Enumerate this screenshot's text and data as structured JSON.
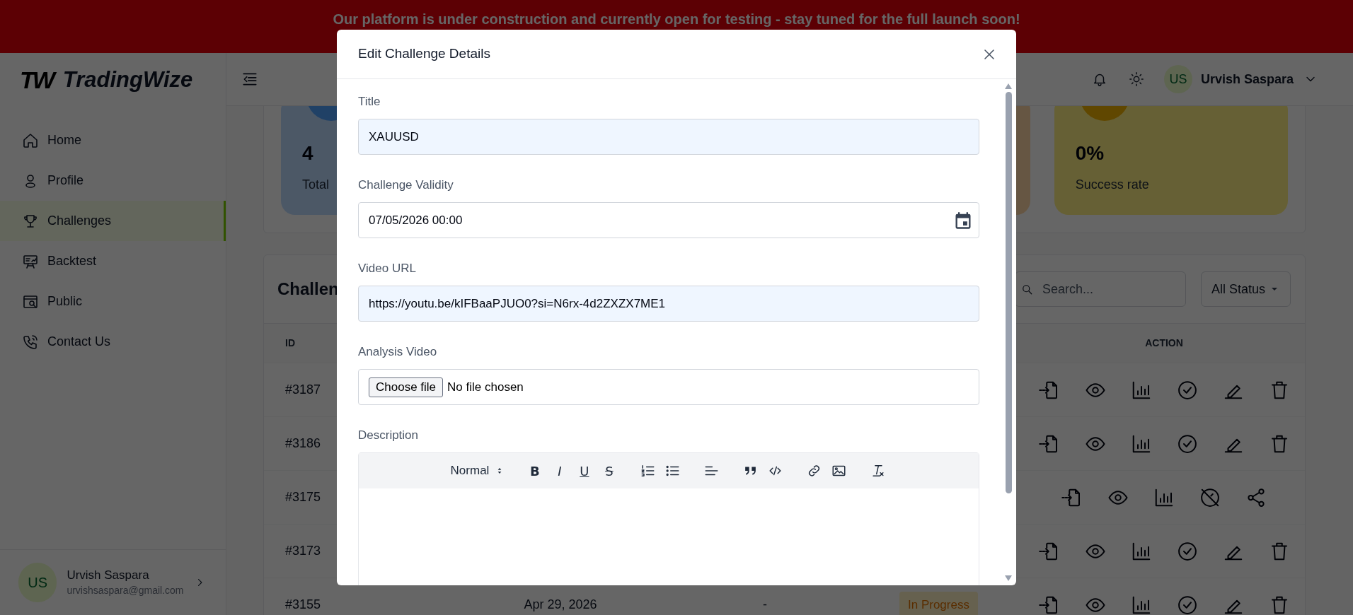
{
  "banner": {
    "text": "Our platform is under construction and currently open for testing - stay tuned for the full launch soon!"
  },
  "sidebar": {
    "logo_mark": "TW",
    "logo_text": "TradingWize",
    "nav": [
      {
        "label": "Home",
        "selected": false
      },
      {
        "label": "Profile",
        "selected": false
      },
      {
        "label": "Challenges",
        "selected": true
      },
      {
        "label": "Backtest",
        "selected": false
      },
      {
        "label": "Public",
        "selected": false
      },
      {
        "label": "Contact Us",
        "selected": false
      }
    ],
    "user": {
      "initials": "US",
      "name": "Urvish Saspara",
      "email": "urvishsaspara@gmail.com"
    }
  },
  "header": {
    "user": {
      "initials": "US",
      "name": "Urvish Saspara"
    }
  },
  "stats": [
    {
      "value": "4",
      "label": "Total"
    },
    {
      "value": "0%",
      "label": "Success rate"
    }
  ],
  "table": {
    "title": "Challen",
    "search": {
      "placeholder": "Search..."
    },
    "filter": "All Status",
    "columns": [
      "ID",
      "ACTION"
    ],
    "rows": [
      {
        "id": "#3187",
        "actions": [
          {
            "kind": "import"
          },
          {
            "kind": "view"
          },
          {
            "kind": "stats"
          },
          {
            "kind": "complete"
          },
          {
            "kind": "edit"
          },
          {
            "kind": "delete"
          }
        ]
      },
      {
        "id": "#3186",
        "actions": [
          {
            "kind": "import"
          },
          {
            "kind": "view"
          },
          {
            "kind": "stats"
          },
          {
            "kind": "complete"
          },
          {
            "kind": "edit"
          },
          {
            "kind": "delete"
          }
        ]
      },
      {
        "id": "#3175",
        "actions": [
          {
            "kind": "import"
          },
          {
            "kind": "view"
          },
          {
            "kind": "stats"
          },
          {
            "kind": "unpublish"
          },
          {
            "kind": "share"
          }
        ]
      },
      {
        "id": "#3173",
        "actions": [
          {
            "kind": "import"
          },
          {
            "kind": "view"
          },
          {
            "kind": "stats"
          },
          {
            "kind": "complete"
          },
          {
            "kind": "edit"
          },
          {
            "kind": "delete"
          }
        ]
      },
      {
        "id": "#3155",
        "date": "Apr 29, 2026",
        "column_3": "-",
        "status": "In Progress",
        "actions": [
          {
            "kind": "import"
          },
          {
            "kind": "view"
          },
          {
            "kind": "stats"
          },
          {
            "kind": "complete"
          },
          {
            "kind": "edit"
          },
          {
            "kind": "delete"
          }
        ]
      }
    ]
  },
  "modal": {
    "title": "Edit Challenge Details",
    "fields": [
      {
        "kind": "text",
        "label": "Title",
        "value": "XAUUSD",
        "autofilled": true
      },
      {
        "kind": "datetime",
        "label": "Challenge Validity",
        "value": "07/05/2026 00:00",
        "autofilled": false
      },
      {
        "kind": "text",
        "label": "Video URL",
        "value": "https://youtu.be/kIFBaaPJUO0?si=N6rx-4d2ZXZX7ME1",
        "autofilled": true
      },
      {
        "kind": "file",
        "label": "Analysis Video",
        "button": "Choose file",
        "value": "No file chosen"
      },
      {
        "kind": "editor",
        "label": "Description",
        "header": "Normal",
        "tool_groups": [
          [
            {
              "kind": "bold",
              "text": "B"
            },
            {
              "kind": "italic",
              "text": "I"
            },
            {
              "kind": "underline",
              "text": "U"
            },
            {
              "kind": "strike",
              "text": "S"
            }
          ],
          [
            {
              "kind": "ordered"
            },
            {
              "kind": "bullet"
            }
          ],
          [
            {
              "kind": "align"
            }
          ],
          [
            {
              "kind": "blockquote"
            },
            {
              "kind": "code"
            }
          ],
          [
            {
              "kind": "link"
            },
            {
              "kind": "image"
            }
          ],
          [
            {
              "kind": "clean"
            }
          ]
        ]
      }
    ]
  }
}
